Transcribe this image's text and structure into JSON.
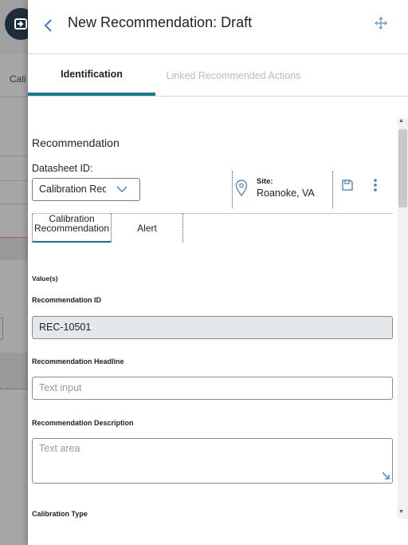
{
  "background": {
    "cut_text": "Cali"
  },
  "header": {
    "title": "New Recommendation: Draft"
  },
  "tabs": [
    {
      "label": "Identification",
      "active": true
    },
    {
      "label": "Linked Recommended Actions",
      "active": false
    }
  ],
  "form": {
    "section_title": "Recommendation",
    "datasheet_label": "Datasheet ID:",
    "datasheet_value": "Calibration Rec",
    "site_label": "Site:",
    "site_value": "Roanoke, VA",
    "subtabs": [
      {
        "label": "Calibration Recommendation"
      },
      {
        "label": "Alert"
      }
    ],
    "values_label": "Value(s)",
    "fields": {
      "rec_id_label": "Recommendation ID",
      "rec_id_value": "REC-10501",
      "headline_label": "Recommendation Headline",
      "headline_placeholder": "Text input",
      "description_label": "Recommendation Description",
      "description_placeholder": "Text area",
      "calibration_type_label": "Calibration Type"
    }
  },
  "colors": {
    "accent": "#127a91",
    "link": "#3b7bd0"
  },
  "icons": {
    "back": "chevron-left-icon",
    "expand": "expand-arrows-icon",
    "dropdown": "chevron-down-icon",
    "site": "map-pin-icon",
    "save": "save-icon",
    "more": "kebab-icon"
  }
}
